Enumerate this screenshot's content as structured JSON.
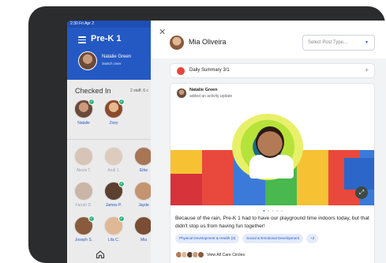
{
  "status_bar": {
    "time": "2:30 Fri Apr 2"
  },
  "sidebar": {
    "class_title": "Pre-K 1",
    "user_name": "Natalie Green",
    "user_sub": "Switch User",
    "checked_in_title": "Checked In",
    "checked_in_count": "2 staff, 6 c",
    "staff": [
      {
        "name": "Natalie"
      },
      {
        "name": "Zoey"
      }
    ],
    "children": [
      {
        "name": "Alexis T."
      },
      {
        "name": "Andi J."
      },
      {
        "name": "Ethe"
      },
      {
        "name": "Farrah D."
      },
      {
        "name": "James P."
      },
      {
        "name": "Jayde"
      },
      {
        "name": "Joseph S."
      },
      {
        "name": "Lila C."
      },
      {
        "name": "Mia"
      }
    ]
  },
  "modal": {
    "author_name": "Mia Oliveira",
    "post_type_placeholder": "Select Post Type...",
    "daily_summary_label": "Daily Summary 3/1",
    "post": {
      "poster_name": "Natalie Green",
      "poster_action": "added an activity update",
      "caption": "Because of the rain, Pre-K 1 had to have our playground time indoors today, but that didn't stop us from having fun together!",
      "tags": [
        "Physical Development & Health (3)",
        "Social & Emotional Development",
        "+2"
      ],
      "care_circles_label": "View All Care Circles"
    }
  },
  "colors": {
    "brand_blue": "#2459c4",
    "check_green": "#2eb67d",
    "summary_red": "#e8453c"
  }
}
